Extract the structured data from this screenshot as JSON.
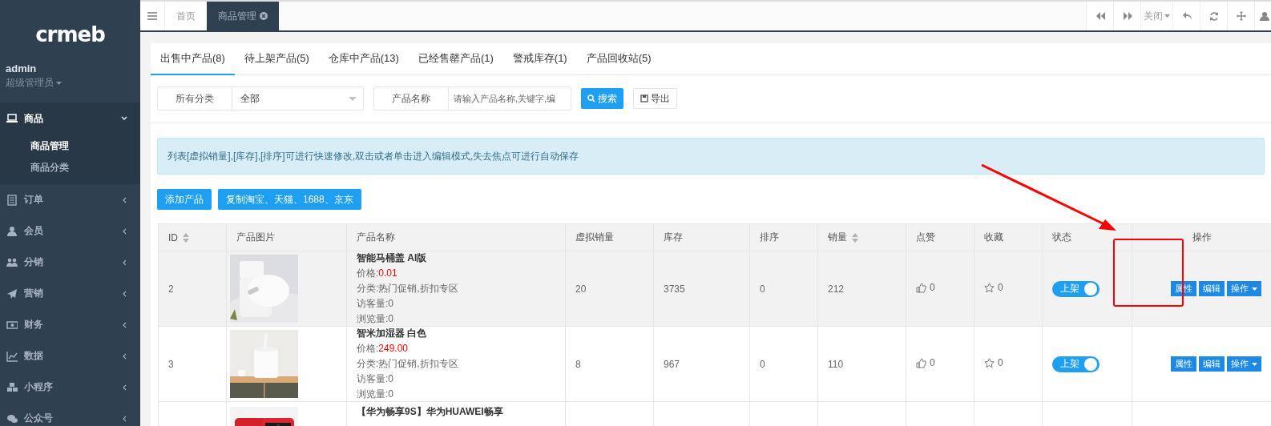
{
  "sidebar": {
    "logo": "crmeb",
    "user": {
      "name": "admin",
      "role": "超级管理员"
    },
    "menu": [
      {
        "label": "商品",
        "expanded": true,
        "children": [
          {
            "label": "商品管理",
            "selected": true
          },
          {
            "label": "商品分类",
            "selected": false
          }
        ]
      },
      {
        "label": "订单",
        "expanded": false
      },
      {
        "label": "会员",
        "expanded": false
      },
      {
        "label": "分销",
        "expanded": false
      },
      {
        "label": "营销",
        "expanded": false
      },
      {
        "label": "财务",
        "expanded": false
      },
      {
        "label": "数据",
        "expanded": false
      },
      {
        "label": "小程序",
        "expanded": false
      },
      {
        "label": "公众号",
        "expanded": false
      }
    ]
  },
  "topbar": {
    "page_tabs": [
      {
        "label": "首页",
        "selected": false,
        "closable": false
      },
      {
        "label": "商品管理",
        "selected": true,
        "closable": true
      }
    ],
    "tools": [
      {
        "kind": "back"
      },
      {
        "kind": "forward"
      },
      {
        "kind": "close-menu",
        "label": "关闭"
      },
      {
        "kind": "undo"
      },
      {
        "kind": "refresh"
      },
      {
        "kind": "move"
      },
      {
        "kind": "partial"
      }
    ]
  },
  "product_tabs": [
    {
      "label": "出售中产品(8)",
      "selected": true
    },
    {
      "label": "待上架产品(5)",
      "selected": false
    },
    {
      "label": "仓库中产品(13)",
      "selected": false
    },
    {
      "label": "已经售罄产品(1)",
      "selected": false
    },
    {
      "label": "警戒库存(1)",
      "selected": false
    },
    {
      "label": "产品回收站(5)",
      "selected": false
    }
  ],
  "filters": {
    "category_label": "所有分类",
    "category_value": "全部",
    "name_label": "产品名称",
    "name_placeholder": "请输入产品名称,关键字,编",
    "search_button": "搜索",
    "export_button": "导出"
  },
  "notice": "列表[虚拟销量],[库存],[排序]可进行快速修改,双击或者单击进入编辑模式,失去焦点可进行自动保存",
  "action_buttons": [
    "添加产品",
    "复制淘宝、天猫、1688、京东"
  ],
  "table": {
    "columns": [
      {
        "label": "ID",
        "sortable": true
      },
      {
        "label": "产品图片",
        "sortable": false
      },
      {
        "label": "产品名称",
        "sortable": false
      },
      {
        "label": "虚拟销量",
        "sortable": false
      },
      {
        "label": "库存",
        "sortable": false
      },
      {
        "label": "排序",
        "sortable": false
      },
      {
        "label": "销量",
        "sortable": true
      },
      {
        "label": "点赞",
        "sortable": false
      },
      {
        "label": "收藏",
        "sortable": false
      },
      {
        "label": "状态",
        "sortable": false
      },
      {
        "label": "操作",
        "sortable": false
      }
    ],
    "rows": [
      {
        "id": "2",
        "name": "智能马桶盖 AI版",
        "price_label": "价格:",
        "price": "0.01",
        "category": "分类:热门促销,折扣专区",
        "visitors": "访客量:0",
        "views": "浏览量:0",
        "virtual_sales": "20",
        "stock": "3735",
        "sort": "0",
        "sales": "212",
        "likes": "0",
        "collects": "0",
        "status": {
          "label": "上架",
          "on": true
        },
        "buttons": [
          "属性",
          "编辑",
          "操作"
        ],
        "highlighted": true
      },
      {
        "id": "3",
        "name": "智米加湿器 白色",
        "price_label": "价格:",
        "price": "249.00",
        "category": "分类:热门促销,折扣专区",
        "visitors": "访客量:0",
        "views": "浏览量:0",
        "virtual_sales": "8",
        "stock": "967",
        "sort": "0",
        "sales": "110",
        "likes": "0",
        "collects": "0",
        "status": {
          "label": "上架",
          "on": true
        },
        "buttons": [
          "属性",
          "编辑",
          "操作"
        ],
        "highlighted": false
      },
      {
        "name": "【华为畅享9S】华为HUAWEI畅享",
        "highlighted": false
      }
    ]
  },
  "annotation": {
    "kind": "arrow-to-frame"
  }
}
